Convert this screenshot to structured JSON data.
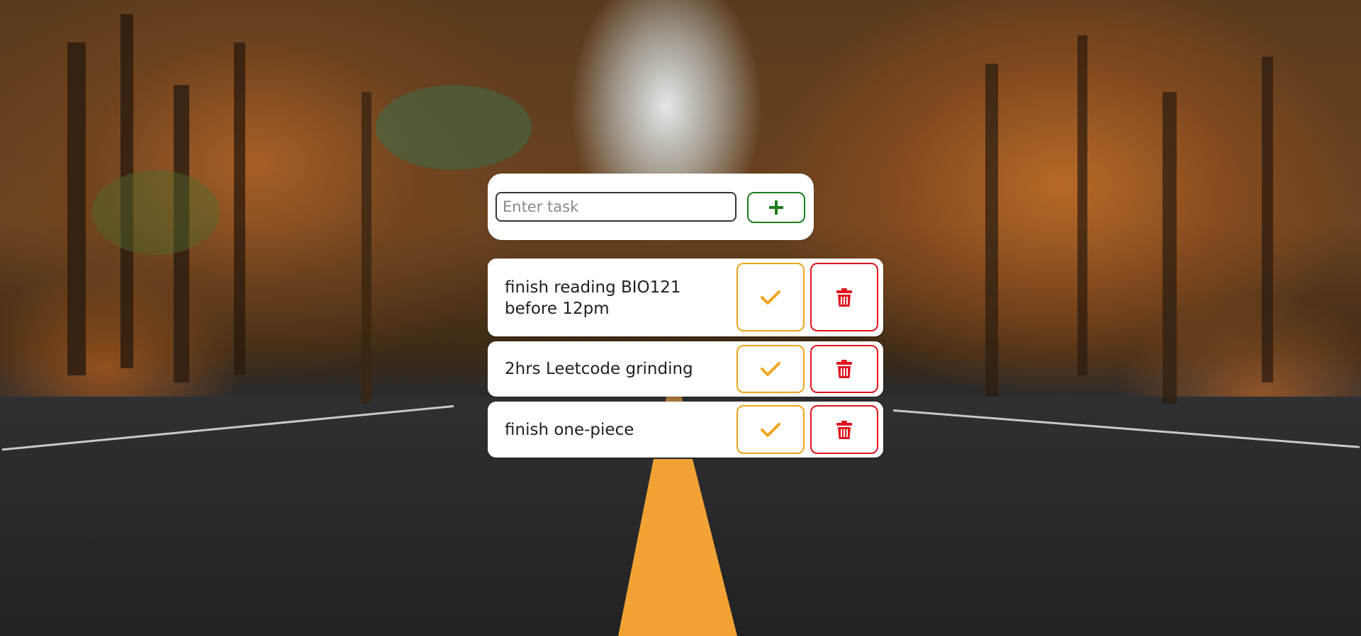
{
  "input": {
    "placeholder": "Enter task",
    "value": ""
  },
  "add_button": {
    "icon": "plus-icon",
    "color": "#1b7d1b"
  },
  "tasks": [
    {
      "text": "finish reading BIO121 before 12pm"
    },
    {
      "text": "2hrs Leetcode grinding"
    },
    {
      "text": "finish one-piece"
    }
  ],
  "task_actions": {
    "complete_icon": "check-icon",
    "complete_color": "#f0a51b",
    "delete_icon": "trash-icon",
    "delete_color": "#e0141e"
  }
}
